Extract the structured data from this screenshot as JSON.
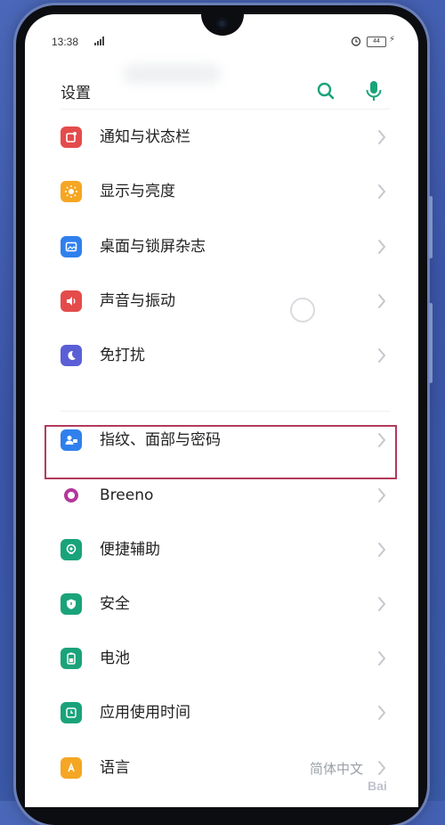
{
  "status_bar": {
    "time": "13:38",
    "signal_icon": "signal-icon",
    "alarm_icon": "alarm-icon",
    "battery_level": "44",
    "charge_icon": "charge-icon"
  },
  "header": {
    "title": "设置",
    "search_icon": "search-icon",
    "voice_icon": "mic-icon",
    "accent_color": "#1aa37a"
  },
  "settings": {
    "items": [
      {
        "label": "通知与状态栏",
        "icon": "notification-icon",
        "color": "#e54b4b"
      },
      {
        "label": "显示与亮度",
        "icon": "brightness-icon",
        "color": "#f5a623"
      },
      {
        "label": "桌面与锁屏杂志",
        "icon": "wallpaper-icon",
        "color": "#2f80ed"
      },
      {
        "label": "声音与振动",
        "icon": "sound-icon",
        "color": "#e54b4b"
      },
      {
        "label": "免打扰",
        "icon": "moon-icon",
        "color": "#5b5fd6"
      },
      {
        "label": "指纹、面部与密码",
        "icon": "user-lock-icon",
        "color": "#2f80ed"
      },
      {
        "label": "Breeno",
        "icon": "breeno-icon",
        "color": "#b3379b"
      },
      {
        "label": "便捷辅助",
        "icon": "assist-icon",
        "color": "#1aa37a"
      },
      {
        "label": "安全",
        "icon": "shield-icon",
        "color": "#1aa37a"
      },
      {
        "label": "电池",
        "icon": "battery-icon",
        "color": "#1aa37a"
      },
      {
        "label": "应用使用时间",
        "icon": "app-usage-icon",
        "color": "#1aa37a"
      },
      {
        "label": "语言",
        "icon": "language-icon",
        "color": "#f5a623",
        "value": "简体中文"
      }
    ]
  },
  "highlight_color": "#b33a5c",
  "watermark": "Bai"
}
